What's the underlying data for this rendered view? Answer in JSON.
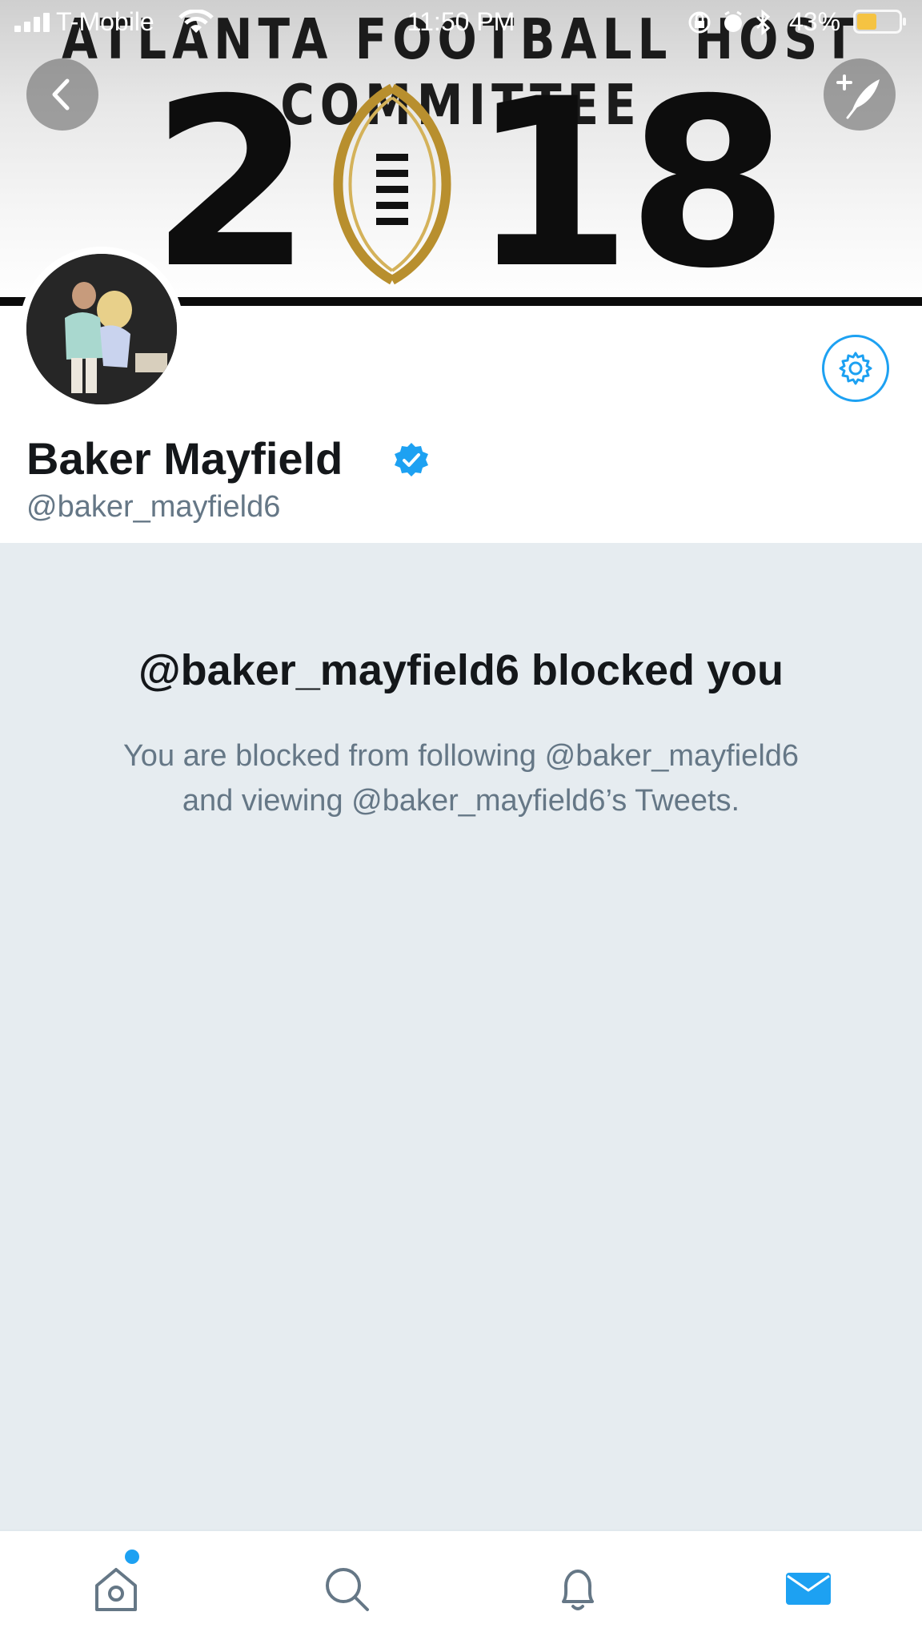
{
  "status_bar": {
    "carrier": "T-Mobile",
    "time": "11:50 PM",
    "battery_percent": "43%",
    "icons": [
      "signal-icon",
      "wifi-icon",
      "orientation-lock-icon",
      "alarm-icon",
      "bluetooth-icon",
      "battery-icon"
    ]
  },
  "banner": {
    "top_text": "ATLANTA FOOTBALL HOST COMMITTEE",
    "year_left": "2",
    "year_right": "18"
  },
  "header_buttons": {
    "back": "back-arrow-icon",
    "compose": "compose-tweet-icon"
  },
  "profile": {
    "display_name": "Baker Mayfield",
    "handle": "@baker_mayfield6",
    "verified": true,
    "settings_icon": "gear-icon"
  },
  "blocked": {
    "title": "@baker_mayfield6 blocked you",
    "line1": "You are blocked from following @baker_mayfield6",
    "line2": "and viewing @baker_mayfield6’s Tweets."
  },
  "tab_bar": {
    "items": [
      "home-icon",
      "search-icon",
      "notifications-icon",
      "messages-icon"
    ],
    "active": "messages-icon",
    "home_has_badge": true
  },
  "colors": {
    "accent": "#1da1f2",
    "background": "#e6ecf0",
    "secondary_text": "#657786",
    "primary_text": "#14171a"
  }
}
